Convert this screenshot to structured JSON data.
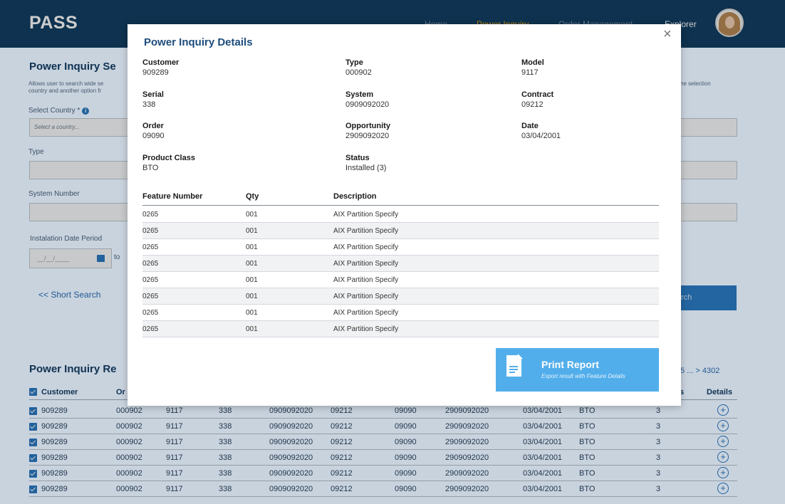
{
  "header": {
    "logo": "PASS",
    "nav": [
      "Home",
      "Power Inquiry",
      "Order Management",
      "Explorer"
    ]
  },
  "search_panel": {
    "title": "Power Inquiry Se",
    "desc_line1": "Allows user to search wide se",
    "desc_line2": "country and another option fr",
    "desc_right": "he selection",
    "country_label": "Select Country *",
    "country_placeholder": "Select a country...",
    "type_label": "Type",
    "system_label": "System Number",
    "date_label": "Instalation Date Period",
    "date_placeholder": "__/__/____",
    "to_label": "to",
    "short_search": "<< Short Search",
    "search_button": "rch"
  },
  "results": {
    "title": "Power Inquiry Re",
    "pagination": "5 ... >  4302",
    "columns": [
      "Customer",
      "Or",
      "",
      "",
      "",
      "",
      "",
      "",
      "",
      "",
      "s",
      "Details"
    ],
    "rows": [
      [
        "909289",
        "000902",
        "9117",
        "338",
        "0909092020",
        "09212",
        "09090",
        "2909092020",
        "03/04/2001",
        "BTO",
        "3"
      ],
      [
        "909289",
        "000902",
        "9117",
        "338",
        "0909092020",
        "09212",
        "09090",
        "2909092020",
        "03/04/2001",
        "BTO",
        "3"
      ],
      [
        "909289",
        "000902",
        "9117",
        "338",
        "0909092020",
        "09212",
        "09090",
        "2909092020",
        "03/04/2001",
        "BTO",
        "3"
      ],
      [
        "909289",
        "000902",
        "9117",
        "338",
        "0909092020",
        "09212",
        "09090",
        "2909092020",
        "03/04/2001",
        "BTO",
        "3"
      ],
      [
        "909289",
        "000902",
        "9117",
        "338",
        "0909092020",
        "09212",
        "09090",
        "2909092020",
        "03/04/2001",
        "BTO",
        "3"
      ],
      [
        "909289",
        "000902",
        "9117",
        "338",
        "0909092020",
        "09212",
        "09090",
        "2909092020",
        "03/04/2001",
        "BTO",
        "3"
      ]
    ]
  },
  "modal": {
    "title": "Power Inquiry Details",
    "close": "×",
    "fields": [
      {
        "label": "Customer",
        "value": "909289"
      },
      {
        "label": "Type",
        "value": "000902"
      },
      {
        "label": "Model",
        "value": "9117"
      },
      {
        "label": "Serial",
        "value": "338"
      },
      {
        "label": "System",
        "value": "0909092020"
      },
      {
        "label": "Contract",
        "value": "09212"
      },
      {
        "label": "Order",
        "value": "09090"
      },
      {
        "label": "Opportunity",
        "value": "2909092020"
      },
      {
        "label": "Date",
        "value": "03/04/2001"
      },
      {
        "label": "Product Class",
        "value": "BTO"
      },
      {
        "label": "Status",
        "value": "Installed (3)"
      }
    ],
    "feature_columns": [
      "Feature Number",
      "Qty",
      "Description"
    ],
    "features": [
      [
        "0265",
        "001",
        "AIX Partition Specify"
      ],
      [
        "0265",
        "001",
        "AIX Partition Specify"
      ],
      [
        "0265",
        "001",
        "AIX Partition Specify"
      ],
      [
        "0265",
        "001",
        "AIX Partition Specify"
      ],
      [
        "0265",
        "001",
        "AIX Partition Specify"
      ],
      [
        "0265",
        "001",
        "AIX Partition Specify"
      ],
      [
        "0265",
        "001",
        "AIX Partition Specify"
      ],
      [
        "0265",
        "001",
        "AIX Partition Specify"
      ]
    ],
    "print_title": "Print Report",
    "print_subtitle": "Export result with Feature Details"
  },
  "colors": {
    "header_bg": "#123f63",
    "accent": "#2a7bc4",
    "nav_active": "#e3a820",
    "print_button": "#52aeeb"
  },
  "icons": [
    "info-icon",
    "calendar-icon",
    "checkbox-icon",
    "plus-circle-icon",
    "close-icon",
    "document-icon",
    "avatar"
  ]
}
